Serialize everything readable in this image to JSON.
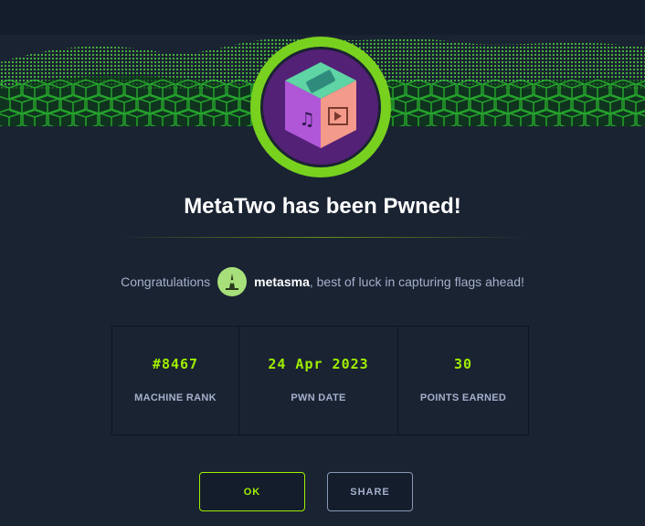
{
  "modal": {
    "title": "MetaTwo has been Pwned!",
    "congrats_prefix": "Congratulations",
    "username": "metasma",
    "congrats_suffix": ", best of luck in capturing flags ahead!",
    "badge_icon": "cube-music-video-icon",
    "avatar_icon": "user-avatar-icon"
  },
  "stats": [
    {
      "value": "#8467",
      "label": "MACHINE RANK"
    },
    {
      "value": "24 Apr 2023",
      "label": "PWN DATE"
    },
    {
      "value": "30",
      "label": "POINTS EARNED"
    }
  ],
  "buttons": {
    "ok": "OK",
    "share": "SHARE"
  },
  "colors": {
    "accent": "#9fef00",
    "background": "#1a2332",
    "text_muted": "#a4b1cd"
  }
}
